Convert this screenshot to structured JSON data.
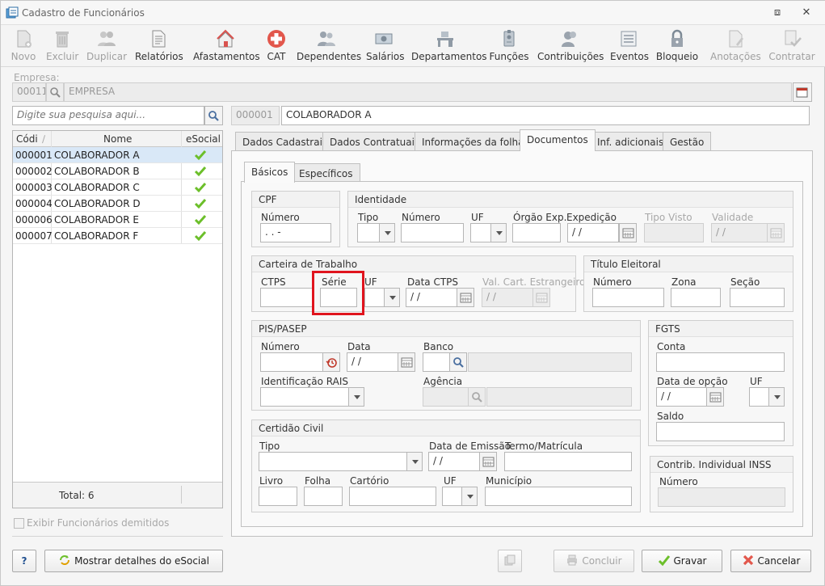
{
  "window": {
    "title": "Cadastro de Funcionários",
    "minimize": "⧈",
    "close": "✕"
  },
  "toolbar": [
    {
      "label": "Novo",
      "icon": "new-document-icon",
      "enabled": false
    },
    {
      "label": "Excluir",
      "icon": "trash-icon",
      "enabled": false
    },
    {
      "label": "Duplicar",
      "icon": "users-icon",
      "enabled": false
    },
    {
      "label": "Relatórios",
      "icon": "report-icon",
      "enabled": true
    },
    {
      "label": "Afastamentos",
      "icon": "house-icon",
      "enabled": true
    },
    {
      "label": "CAT",
      "icon": "medical-cross-icon",
      "enabled": true
    },
    {
      "label": "Dependentes",
      "icon": "family-icon",
      "enabled": true
    },
    {
      "label": "Salários",
      "icon": "money-icon",
      "enabled": true
    },
    {
      "label": "Departamentos",
      "icon": "desk-icon",
      "enabled": true
    },
    {
      "label": "Funções",
      "icon": "badge-icon",
      "enabled": true
    },
    {
      "label": "Contribuições",
      "icon": "people-icon",
      "enabled": true
    },
    {
      "label": "Eventos",
      "icon": "list-icon",
      "enabled": true
    },
    {
      "label": "Bloqueio",
      "icon": "lock-icon",
      "enabled": true
    },
    {
      "label": "Anotações",
      "icon": "notes-icon",
      "enabled": false
    },
    {
      "label": "Contratar",
      "icon": "contract-icon",
      "enabled": false
    }
  ],
  "empresa": {
    "label": "Empresa:",
    "code": "00011",
    "name": "EMPRESA"
  },
  "search": {
    "placeholder": "Digite sua pesquisa aqui..."
  },
  "selected": {
    "code": "000001",
    "name": "COLABORADOR A"
  },
  "list": {
    "headers": {
      "code": "Códi",
      "name": "Nome",
      "esocial": "eSocial"
    },
    "rows": [
      {
        "code": "000001",
        "name": "COLABORADOR A"
      },
      {
        "code": "000002",
        "name": "COLABORADOR B"
      },
      {
        "code": "000003",
        "name": "COLABORADOR C"
      },
      {
        "code": "000004",
        "name": "COLABORADOR D"
      },
      {
        "code": "000006",
        "name": "COLABORADOR E"
      },
      {
        "code": "000007",
        "name": "COLABORADOR F"
      }
    ],
    "total": "Total: 6"
  },
  "exibir_demitidos": "Exibir Funcionários demitidos",
  "tabs": [
    "Dados Cadastrais",
    "Dados Contratuais",
    "Informações da folha",
    "Documentos",
    "Inf. adicionais",
    "Gestão"
  ],
  "subtabs": [
    "Básicos",
    "Específicos"
  ],
  "cpf": {
    "title": "CPF",
    "numero_label": "Número",
    "numero_value": " .  .  -"
  },
  "identidade": {
    "title": "Identidade",
    "tipo": "Tipo",
    "numero": "Número",
    "uf": "UF",
    "orgao": "Órgão Exp.",
    "expedicao": "Expedição",
    "tipo_visto": "Tipo Visto",
    "validade": "Validade",
    "date_value": " / /"
  },
  "ctps": {
    "title": "Carteira de Trabalho",
    "ctps": "CTPS",
    "serie": "Série",
    "uf": "UF",
    "data": "Data CTPS",
    "val": "Val. Cart. Estrangeiro",
    "date_value": " / /"
  },
  "titulo": {
    "title": "Título Eleitoral",
    "numero": "Número",
    "zona": "Zona",
    "secao": "Seção"
  },
  "pis": {
    "title": "PIS/PASEP",
    "numero": "Número",
    "data": "Data",
    "banco": "Banco",
    "rais": "Identificação RAIS",
    "agencia": "Agência",
    "date_value": " / /"
  },
  "fgts": {
    "title": "FGTS",
    "conta": "Conta",
    "data_opcao": "Data de opção",
    "uf": "UF",
    "saldo": "Saldo",
    "date_value": " / /"
  },
  "certidao": {
    "title": "Certidão Civil",
    "tipo": "Tipo",
    "data_emissao": "Data de Emissão",
    "termo": "Termo/Matrícula",
    "livro": "Livro",
    "folha": "Folha",
    "cartorio": "Cartório",
    "uf": "UF",
    "municipio": "Município",
    "date_value": " / /"
  },
  "inss": {
    "title": "Contrib. Individual INSS",
    "numero": "Número"
  },
  "bottom": {
    "help": "?",
    "esocial": "Mostrar detalhes do eSocial",
    "concluir": "Concluir",
    "gravar": "Gravar",
    "cancelar": "Cancelar"
  },
  "colors": {
    "selection": "#d9e8f7",
    "highlight": "#e0141e",
    "check": "#6cbf2a"
  }
}
